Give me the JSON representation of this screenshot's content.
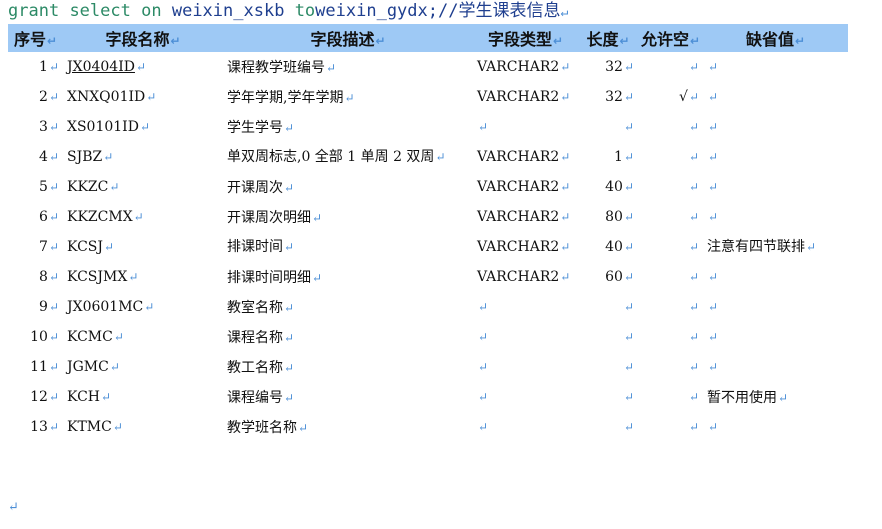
{
  "code": {
    "kw1": "grant",
    "kw2": "select",
    "kw3": "on",
    "object": "weixin_xskb",
    "kw4": "to",
    "user": "weixin_gydx;",
    "comment": "//学生课表信息"
  },
  "table": {
    "headers": [
      "序号",
      "字段名称",
      "字段描述",
      "字段类型",
      "长度",
      "允许空",
      "缺省值"
    ],
    "rows": [
      {
        "no": "1",
        "name": "JX0404ID",
        "desc": "课程教学班编号",
        "type": "VARCHAR2",
        "len": "32",
        "nullable": "",
        "default": ""
      },
      {
        "no": "2",
        "name": "XNXQ01ID",
        "desc": "学年学期,学年学期",
        "type": "VARCHAR2",
        "len": "32",
        "nullable": "√",
        "default": ""
      },
      {
        "no": "3",
        "name": "XS0101ID",
        "desc": "学生学号",
        "type": "",
        "len": "",
        "nullable": "",
        "default": ""
      },
      {
        "no": "4",
        "name": "SJBZ",
        "desc": "单双周标志,0 全部 1 单周 2 双周",
        "type": "VARCHAR2",
        "len": "1",
        "nullable": "",
        "default": ""
      },
      {
        "no": "5",
        "name": "KKZC",
        "desc": "开课周次",
        "type": "VARCHAR2",
        "len": "40",
        "nullable": "",
        "default": ""
      },
      {
        "no": "6",
        "name": "KKZCMX",
        "desc": "开课周次明细",
        "type": "VARCHAR2",
        "len": "80",
        "nullable": "",
        "default": ""
      },
      {
        "no": "7",
        "name": "KCSJ",
        "desc": "排课时间",
        "type": "VARCHAR2",
        "len": "40",
        "nullable": "",
        "default": "注意有四节联排"
      },
      {
        "no": "8",
        "name": "KCSJMX",
        "desc": "排课时间明细",
        "type": "VARCHAR2",
        "len": "60",
        "nullable": "",
        "default": ""
      },
      {
        "no": "9",
        "name": "JX0601MC",
        "desc": "教室名称",
        "type": "",
        "len": "",
        "nullable": "",
        "default": ""
      },
      {
        "no": "10",
        "name": "KCMC",
        "desc": "课程名称",
        "type": "",
        "len": "",
        "nullable": "",
        "default": ""
      },
      {
        "no": "11",
        "name": "JGMC",
        "desc": "教工名称",
        "type": "",
        "len": "",
        "nullable": "",
        "default": ""
      },
      {
        "no": "12",
        "name": "KCH",
        "desc": "课程编号",
        "type": "",
        "len": "",
        "nullable": "",
        "default": "暂不用使用"
      },
      {
        "no": "13",
        "name": "KTMC",
        "desc": "教学班名称",
        "type": "",
        "len": "",
        "nullable": "",
        "default": ""
      }
    ]
  }
}
